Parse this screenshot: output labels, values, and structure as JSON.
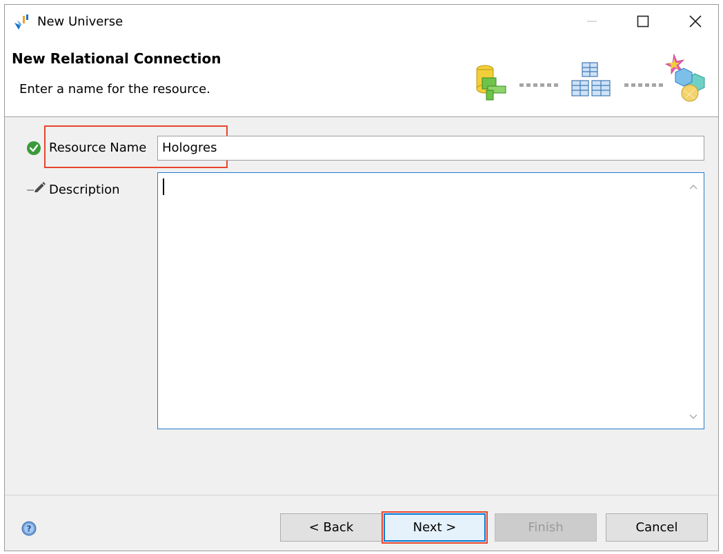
{
  "window": {
    "title": "New Universe"
  },
  "header": {
    "title": "New Relational Connection",
    "subtitle": "Enter a name for the resource.",
    "steps": [
      "database-connection-icon",
      "tables-icon",
      "universe-shapes-icon"
    ]
  },
  "form": {
    "resource_name_label": "Resource Name",
    "resource_name_value": "Hologres",
    "description_label": "Description",
    "description_value": ""
  },
  "buttons": {
    "back": "< Back",
    "next": "Next >",
    "finish": "Finish",
    "cancel": "Cancel"
  },
  "colors": {
    "highlight": "#e8442c",
    "focus": "#1f7ad0",
    "valid": "#3a9a3a"
  }
}
